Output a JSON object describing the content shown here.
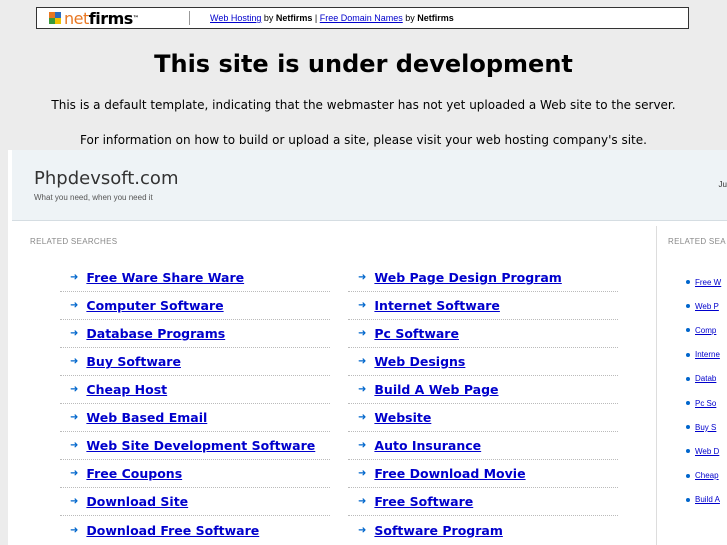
{
  "topbar": {
    "logo_net": "net",
    "logo_firms": "firms",
    "logo_tm": "™",
    "link1": "Web Hosting",
    "by1": " by ",
    "brand1": "Netfirms",
    "sep": " | ",
    "link2": "Free Domain Names",
    "by2": " by ",
    "brand2": "Netfirms"
  },
  "headline": "This site is under development",
  "line1": "This is a default template, indicating that the webmaster has not yet uploaded a Web site to the server.",
  "line2": "For information on how to build or upload a site, please visit your web hosting company's site.",
  "frame": {
    "site_title": "Phpdevsoft.com",
    "site_sub": "What you need, when you need it",
    "right_text": "Ju",
    "related_label": "RELATED SEARCHES",
    "related_label_right": "RELATED SEA",
    "col1": [
      "Free Ware Share Ware",
      "Computer Software",
      "Database Programs",
      "Buy Software",
      "Cheap Host",
      "Web Based Email",
      "Web Site Development Software",
      "Free Coupons",
      "Download Site",
      "Download Free Software"
    ],
    "col2": [
      "Web Page Design Program",
      "Internet Software",
      "Pc Software",
      "Web Designs",
      "Build A Web Page",
      "Website",
      "Auto Insurance",
      "Free Download Movie",
      "Free Software",
      "Software Program"
    ],
    "col3": [
      "Free W",
      "Web P",
      "Comp",
      "Interne",
      "Datab",
      "Pc So",
      "Buy S",
      "Web D",
      "Cheap",
      "Build A"
    ]
  },
  "colors": {
    "background": "#ececec",
    "link": "#0000cc",
    "arrow": "#0066cc",
    "header_bg": "#eef3f6",
    "logo_orange": "#e87722"
  }
}
